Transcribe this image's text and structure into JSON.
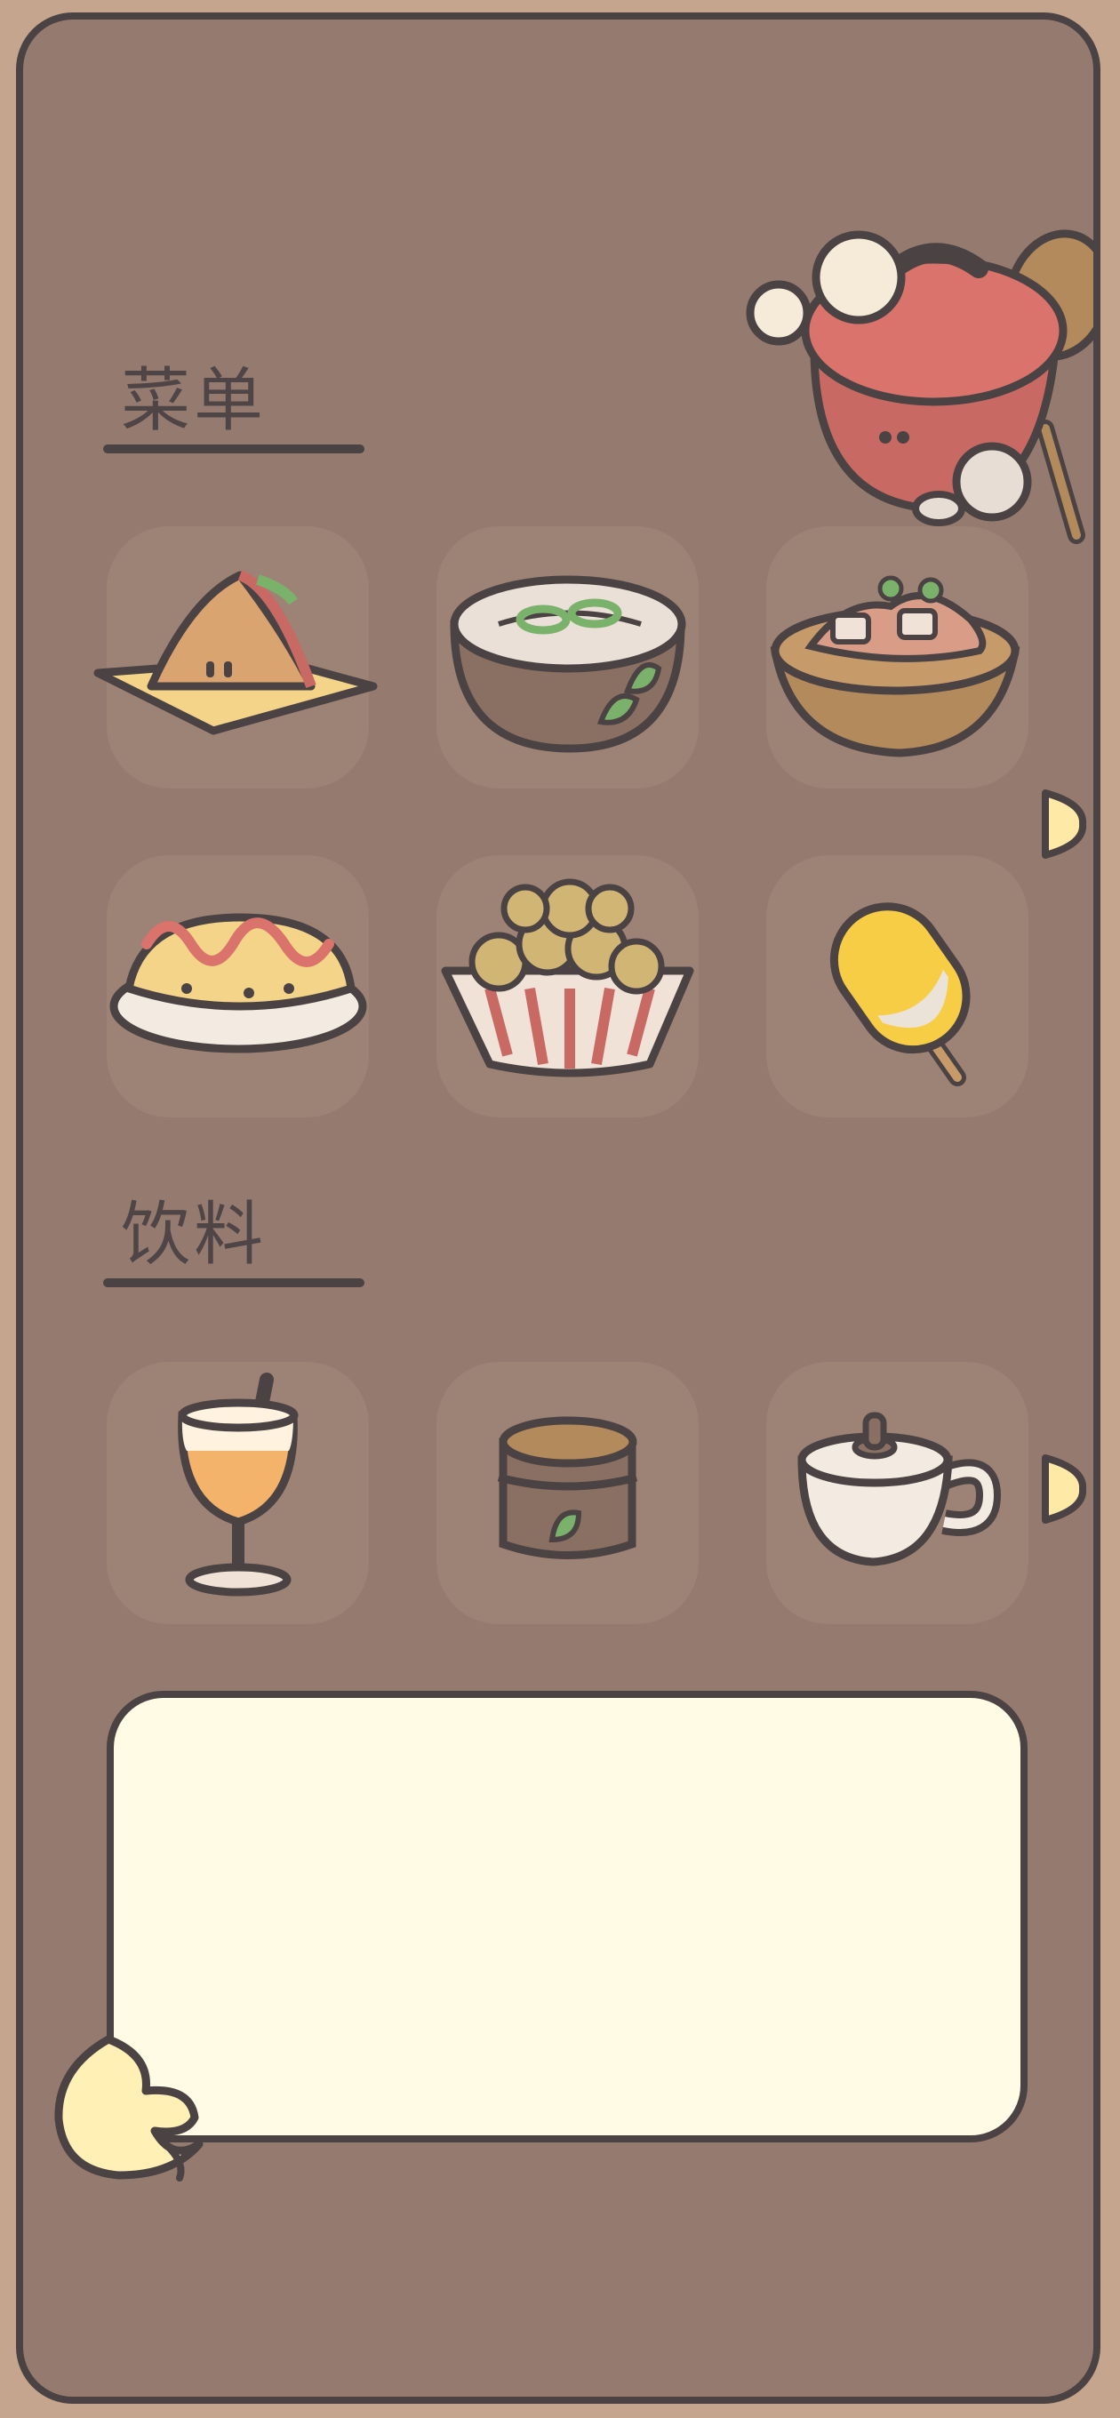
{
  "menu": {
    "food_title": "菜单",
    "drink_title": "饮料",
    "food_items": [
      {
        "icon": "sandwich-icon"
      },
      {
        "icon": "noodle-bowl-icon"
      },
      {
        "icon": "stew-bowl-icon"
      },
      {
        "icon": "omelette-rice-icon"
      },
      {
        "icon": "popcorn-chicken-icon"
      },
      {
        "icon": "grilled-corn-icon"
      }
    ],
    "drink_items": [
      {
        "icon": "parfait-glass-icon"
      },
      {
        "icon": "tea-cup-icon"
      },
      {
        "icon": "coffee-mug-icon"
      }
    ],
    "description_text": ""
  },
  "colors": {
    "background": "#957a6f",
    "outer": "#c6a58f",
    "outline": "#4b4244",
    "tile": "#a4887c",
    "note": "#fffbe4",
    "arrow": "#ffe9a6"
  }
}
